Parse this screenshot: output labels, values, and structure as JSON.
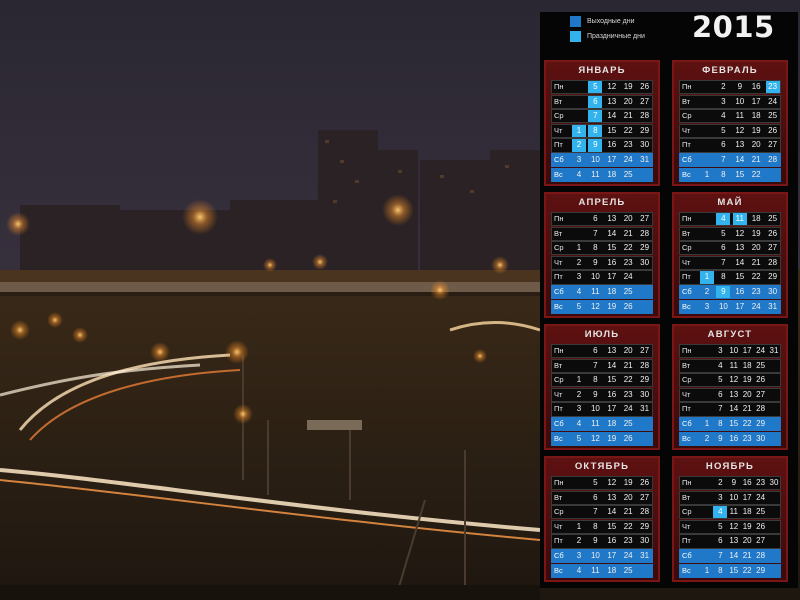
{
  "year": "2015",
  "legend": [
    {
      "label": "Выходные дни",
      "color": "#1f78c8"
    },
    {
      "label": "Праздничные дни",
      "color": "#33b3ee"
    }
  ],
  "weekday_labels": [
    "Пн",
    "Вт",
    "Ср",
    "Чт",
    "Пт",
    "Сб",
    "Вс"
  ],
  "months": [
    {
      "name": "ЯНВАРЬ",
      "rows": [
        [
          "",
          "5",
          "12",
          "19",
          "26"
        ],
        [
          "",
          "6",
          "13",
          "20",
          "27"
        ],
        [
          "",
          "7",
          "14",
          "21",
          "28"
        ],
        [
          "1",
          "8",
          "15",
          "22",
          "29"
        ],
        [
          "2",
          "9",
          "16",
          "23",
          "30"
        ],
        [
          "3",
          "10",
          "17",
          "24",
          "31"
        ],
        [
          "4",
          "11",
          "18",
          "25",
          ""
        ]
      ],
      "highlights": {
        "hol": [
          [
            0,
            1
          ],
          [
            1,
            1
          ],
          [
            2,
            1
          ],
          [
            3,
            0
          ],
          [
            3,
            1
          ],
          [
            4,
            0
          ],
          [
            4,
            1
          ]
        ]
      }
    },
    {
      "name": "ФЕВРАЛЬ",
      "rows": [
        [
          "",
          "2",
          "9",
          "16",
          "23"
        ],
        [
          "",
          "3",
          "10",
          "17",
          "24"
        ],
        [
          "",
          "4",
          "11",
          "18",
          "25"
        ],
        [
          "",
          "5",
          "12",
          "19",
          "26"
        ],
        [
          "",
          "6",
          "13",
          "20",
          "27"
        ],
        [
          "",
          "7",
          "14",
          "21",
          "28"
        ],
        [
          "1",
          "8",
          "15",
          "22",
          ""
        ]
      ],
      "highlights": {
        "hol": [
          [
            0,
            4
          ]
        ]
      }
    },
    {
      "name": "АПРЕЛЬ",
      "rows": [
        [
          "",
          "6",
          "13",
          "20",
          "27"
        ],
        [
          "",
          "7",
          "14",
          "21",
          "28"
        ],
        [
          "1",
          "8",
          "15",
          "22",
          "29"
        ],
        [
          "2",
          "9",
          "16",
          "23",
          "30"
        ],
        [
          "3",
          "10",
          "17",
          "24",
          ""
        ],
        [
          "4",
          "11",
          "18",
          "25",
          ""
        ],
        [
          "5",
          "12",
          "19",
          "26",
          ""
        ]
      ],
      "highlights": {
        "hol": []
      }
    },
    {
      "name": "МАЙ",
      "rows": [
        [
          "",
          "4",
          "11",
          "18",
          "25"
        ],
        [
          "",
          "5",
          "12",
          "19",
          "26"
        ],
        [
          "",
          "6",
          "13",
          "20",
          "27"
        ],
        [
          "",
          "7",
          "14",
          "21",
          "28"
        ],
        [
          "1",
          "8",
          "15",
          "22",
          "29"
        ],
        [
          "2",
          "9",
          "16",
          "23",
          "30"
        ],
        [
          "3",
          "10",
          "17",
          "24",
          "31"
        ]
      ],
      "highlights": {
        "hol": [
          [
            0,
            1
          ],
          [
            0,
            2
          ],
          [
            4,
            0
          ],
          [
            5,
            1
          ]
        ]
      }
    },
    {
      "name": "ИЮЛЬ",
      "rows": [
        [
          "",
          "6",
          "13",
          "20",
          "27"
        ],
        [
          "",
          "7",
          "14",
          "21",
          "28"
        ],
        [
          "1",
          "8",
          "15",
          "22",
          "29"
        ],
        [
          "2",
          "9",
          "16",
          "23",
          "30"
        ],
        [
          "3",
          "10",
          "17",
          "24",
          "31"
        ],
        [
          "4",
          "11",
          "18",
          "25",
          ""
        ],
        [
          "5",
          "12",
          "19",
          "26",
          ""
        ]
      ],
      "highlights": {
        "hol": []
      }
    },
    {
      "name": "АВГУСТ",
      "rows": [
        [
          "",
          "3",
          "10",
          "17",
          "24",
          "31"
        ],
        [
          "",
          "4",
          "11",
          "18",
          "25",
          ""
        ],
        [
          "",
          "5",
          "12",
          "19",
          "26",
          ""
        ],
        [
          "",
          "6",
          "13",
          "20",
          "27",
          ""
        ],
        [
          "",
          "7",
          "14",
          "21",
          "28",
          ""
        ],
        [
          "1",
          "8",
          "15",
          "22",
          "29",
          ""
        ],
        [
          "2",
          "9",
          "16",
          "23",
          "30",
          ""
        ]
      ],
      "highlights": {
        "hol": []
      }
    },
    {
      "name": "ОКТЯБРЬ",
      "rows": [
        [
          "",
          "5",
          "12",
          "19",
          "26"
        ],
        [
          "",
          "6",
          "13",
          "20",
          "27"
        ],
        [
          "",
          "7",
          "14",
          "21",
          "28"
        ],
        [
          "1",
          "8",
          "15",
          "22",
          "29"
        ],
        [
          "2",
          "9",
          "16",
          "23",
          "30"
        ],
        [
          "3",
          "10",
          "17",
          "24",
          "31"
        ],
        [
          "4",
          "11",
          "18",
          "25",
          ""
        ]
      ],
      "highlights": {
        "hol": []
      }
    },
    {
      "name": "НОЯБРЬ",
      "rows": [
        [
          "",
          "2",
          "9",
          "16",
          "23",
          "30"
        ],
        [
          "",
          "3",
          "10",
          "17",
          "24",
          ""
        ],
        [
          "",
          "4",
          "11",
          "18",
          "25",
          ""
        ],
        [
          "",
          "5",
          "12",
          "19",
          "26",
          ""
        ],
        [
          "",
          "6",
          "13",
          "20",
          "27",
          ""
        ],
        [
          "",
          "7",
          "14",
          "21",
          "28",
          ""
        ],
        [
          "1",
          "8",
          "15",
          "22",
          "29",
          ""
        ]
      ],
      "highlights": {
        "hol": [
          [
            2,
            1
          ]
        ]
      }
    }
  ]
}
